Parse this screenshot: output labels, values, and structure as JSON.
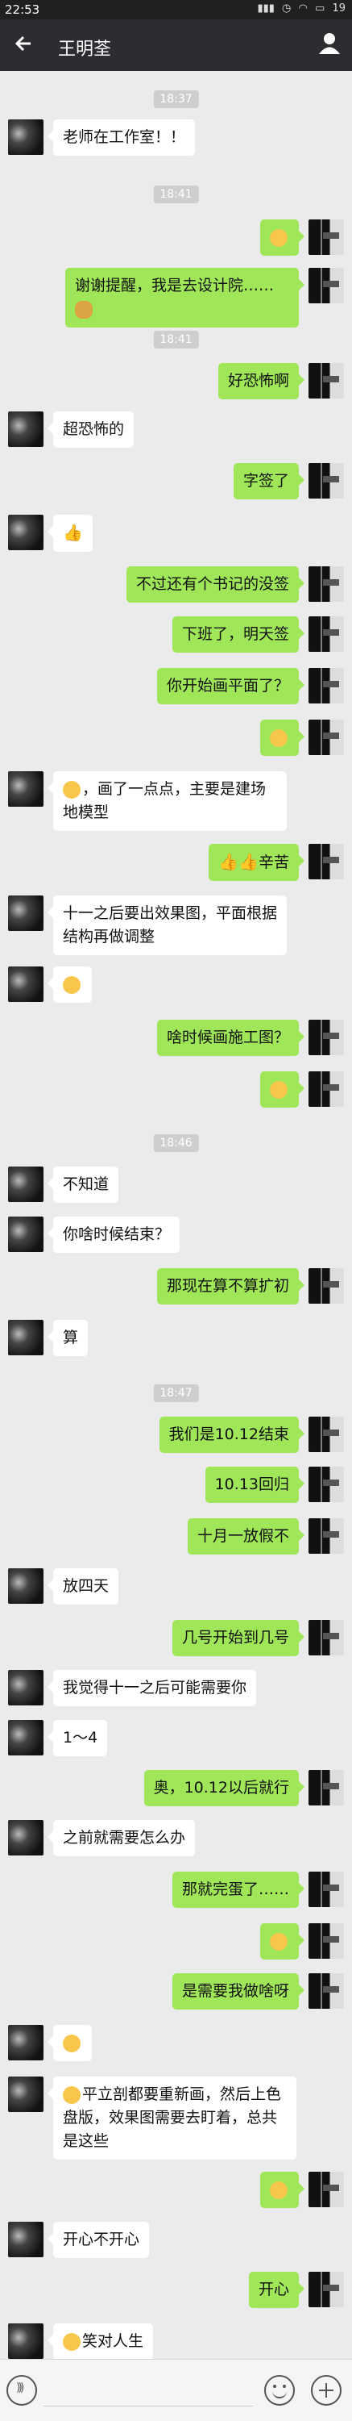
{
  "status_bar": {
    "time": "22:53",
    "battery": "19"
  },
  "header": {
    "title": "王明荃",
    "back_icon": "arrow-left-icon",
    "profile_icon": "person-icon"
  },
  "timestamps": [
    "18:37",
    "18:41",
    "18:41",
    "18:46",
    "18:47"
  ],
  "messages": [
    {
      "side": "left",
      "text": "老师在工作室！！"
    },
    {
      "side": "right",
      "text": "",
      "emoji": "grinning-face"
    },
    {
      "side": "right",
      "text": "谢谢提醒，我是去设计院……",
      "emoji_after": "money-bag"
    },
    {
      "side": "right",
      "text": "好恐怖啊"
    },
    {
      "side": "left",
      "text": "超恐怖的"
    },
    {
      "side": "right",
      "text": "字签了"
    },
    {
      "side": "left",
      "text": "",
      "emoji": "thumbs-up"
    },
    {
      "side": "right",
      "text": "不过还有个书记的没签"
    },
    {
      "side": "right",
      "text": "下班了，明天签"
    },
    {
      "side": "right",
      "text": "你开始画平面了？"
    },
    {
      "side": "right",
      "text": "",
      "emoji": "sweat-smile"
    },
    {
      "side": "left",
      "text": "，画了一点点，主要是建场地模型",
      "emoji": "unamused"
    },
    {
      "side": "right",
      "text": "辛苦",
      "emoji": "thumbs-up-2"
    },
    {
      "side": "left",
      "text": "十一之后要出效果图，平面根据结构再做调整"
    },
    {
      "side": "left",
      "text": "",
      "emoji": "unamused"
    },
    {
      "side": "right",
      "text": "啥时候画施工图？"
    },
    {
      "side": "right",
      "text": "",
      "emoji": "sad"
    },
    {
      "side": "left",
      "text": "不知道"
    },
    {
      "side": "left",
      "text": "你啥时候结束？"
    },
    {
      "side": "right",
      "text": "那现在算不算扩初"
    },
    {
      "side": "left",
      "text": "算"
    },
    {
      "side": "right",
      "text": "我们是10.12结束"
    },
    {
      "side": "right",
      "text": "10.13回归"
    },
    {
      "side": "right",
      "text": "十月一放假不"
    },
    {
      "side": "left",
      "text": "放四天"
    },
    {
      "side": "right",
      "text": "几号开始到几号"
    },
    {
      "side": "left",
      "text": "我觉得十一之后可能需要你"
    },
    {
      "side": "left",
      "text": "1～4"
    },
    {
      "side": "right",
      "text": "奥，10.12以后就行"
    },
    {
      "side": "left",
      "text": "之前就需要怎么办"
    },
    {
      "side": "right",
      "text": "那就完蛋了……"
    },
    {
      "side": "right",
      "text": "",
      "emoji": "grinning-face"
    },
    {
      "side": "right",
      "text": "是需要我做啥呀"
    },
    {
      "side": "left",
      "text": "",
      "emoji": "unamused"
    },
    {
      "side": "left",
      "text": "平立剖都要重新画，然后上色盘版，效果图需要去盯着，总共是这些",
      "emoji": "thinking"
    },
    {
      "side": "right",
      "text": "",
      "emoji": "tongue-wink"
    },
    {
      "side": "left",
      "text": "开心不开心"
    },
    {
      "side": "right",
      "text": "开心"
    },
    {
      "side": "left",
      "text": "笑对人生",
      "emoji": "smile"
    }
  ],
  "bottom_bar": {
    "voice_icon": "voice-icon",
    "emoji_icon": "smile-icon",
    "plus_icon": "plus-icon"
  },
  "colors": {
    "right_bubble": "#9fe658",
    "left_bubble": "#ffffff",
    "titlebar": "#2c2d31"
  }
}
